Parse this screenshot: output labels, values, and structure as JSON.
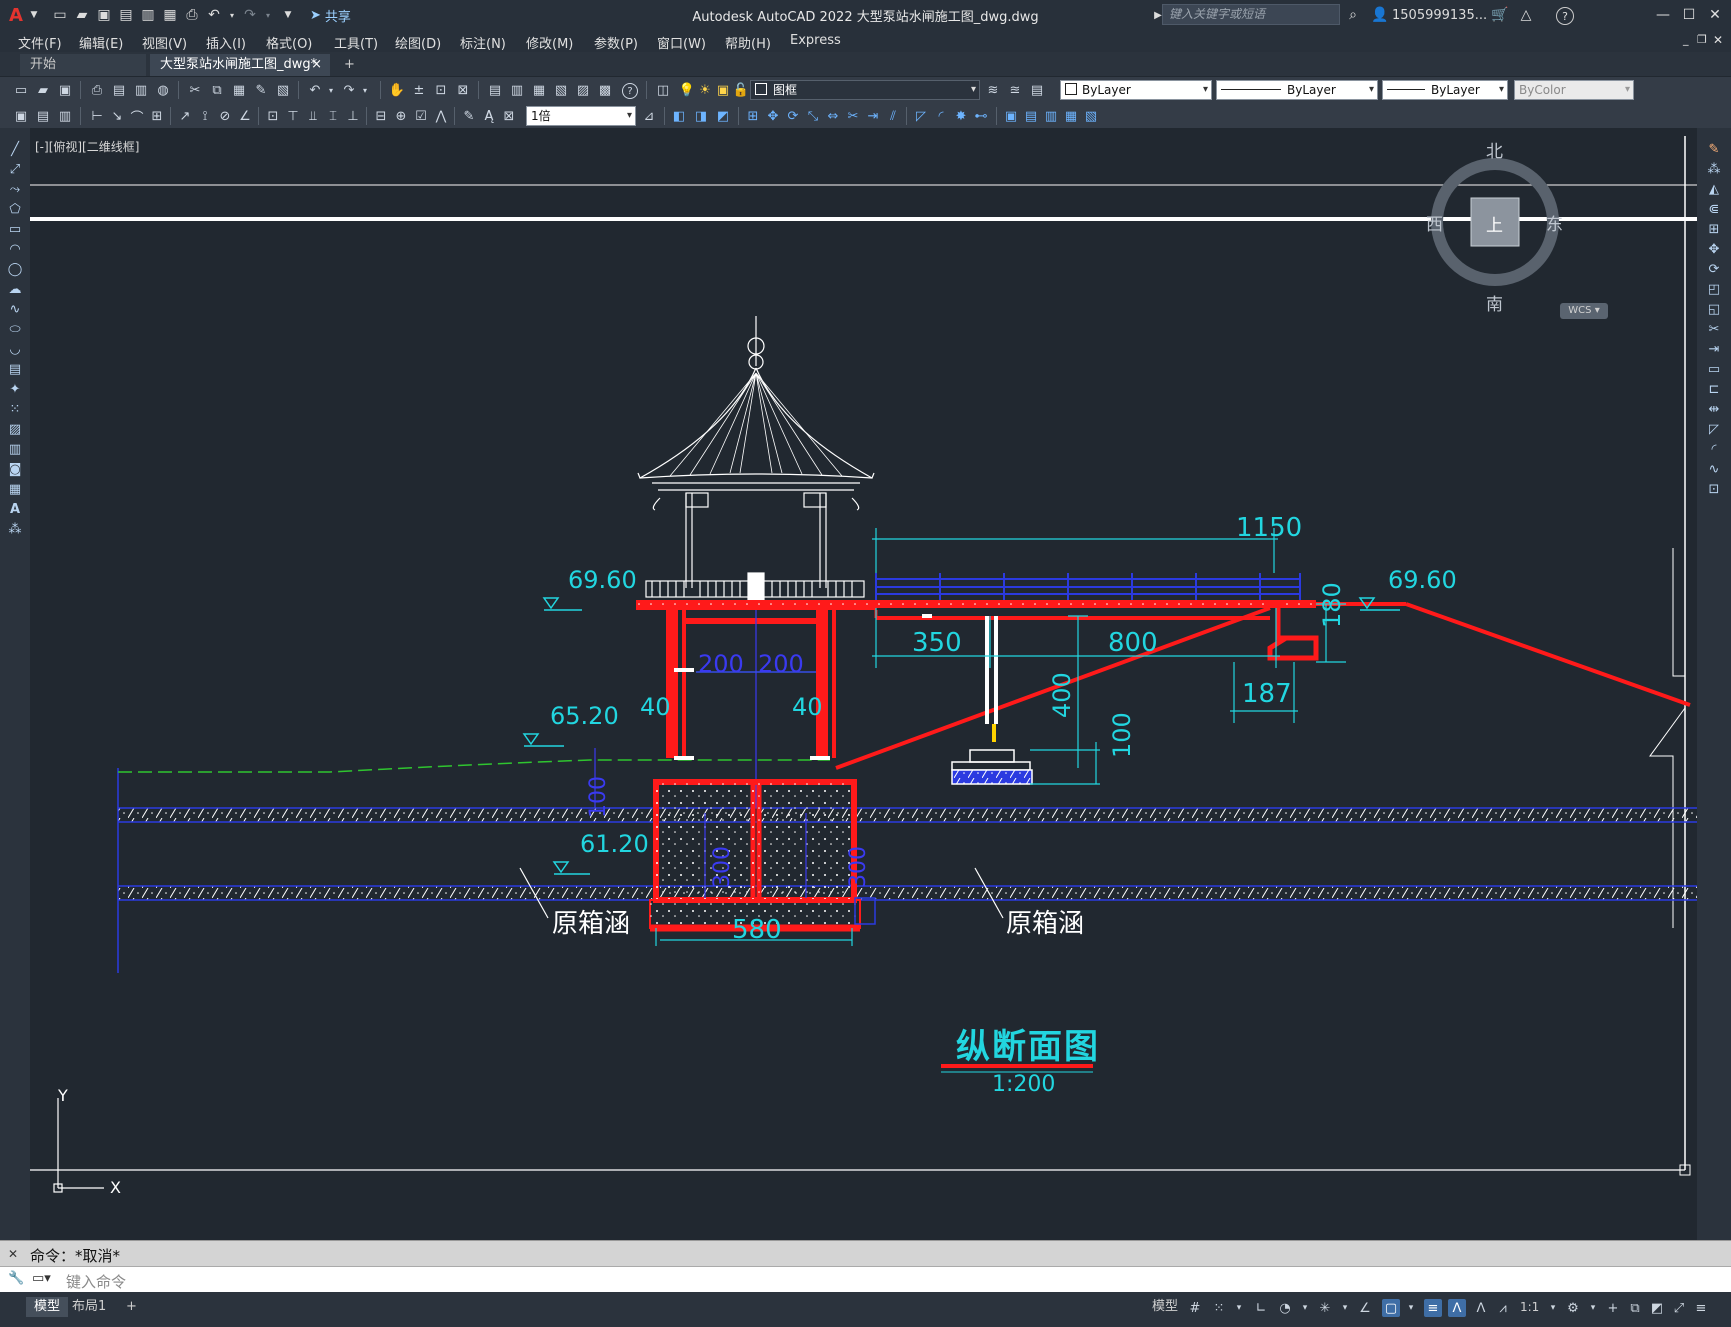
{
  "app": {
    "title": "Autodesk AutoCAD 2022    大型泵站水闸施工图_dwg.dwg",
    "logo_letter": "A",
    "share_label": "共享",
    "search_placeholder": "键入关键字或短语",
    "user": "1505999135...",
    "help": "?"
  },
  "menu": [
    "文件(F)",
    "编辑(E)",
    "视图(V)",
    "插入(I)",
    "格式(O)",
    "工具(T)",
    "绘图(D)",
    "标注(N)",
    "修改(M)",
    "参数(P)",
    "窗口(W)",
    "帮助(H)",
    "Express"
  ],
  "tabs": [
    {
      "label": "开始",
      "active": false
    },
    {
      "label": "大型泵站水闸施工图_dwg*",
      "active": true
    }
  ],
  "tab_close": "×",
  "tab_add": "+",
  "toolbar": {
    "layer": "图框",
    "color": "ByLayer",
    "linetype": "ByLayer",
    "lineweight": "ByLayer",
    "plotstyle": "ByColor",
    "scale": "1倍"
  },
  "viewport": {
    "label": "[-][俯视][二维线框]",
    "compass": {
      "north": "北",
      "south": "南",
      "east": "东",
      "west": "西",
      "top": "上"
    },
    "wcs": "WCS"
  },
  "drawing": {
    "dims": {
      "d1150": "1150",
      "d350": "350",
      "d800": "800",
      "d180": "180",
      "d187": "187",
      "d400": "400",
      "d100": "100",
      "d200a": "200",
      "d200b": "200",
      "d40a": "40",
      "d40b": "40",
      "d580": "580",
      "d300a": "300",
      "d300b": "300",
      "d100b": "100"
    },
    "elevations": {
      "e1": "69.60",
      "e2": "69.60",
      "e3": "65.20",
      "e4": "61.20"
    },
    "labels": {
      "culvert_left": "原箱涵",
      "culvert_right": "原箱涵",
      "section_title": "纵断面图",
      "section_scale": "1:200"
    },
    "axis": {
      "x": "X",
      "y": "Y"
    }
  },
  "command": {
    "history": "命令：*取消*",
    "placeholder": "键入命令"
  },
  "status": {
    "tabs": [
      {
        "label": "模型",
        "active": true
      },
      {
        "label": "布局1",
        "active": false
      }
    ],
    "add": "+",
    "model": "模型",
    "scale": "1:1"
  }
}
